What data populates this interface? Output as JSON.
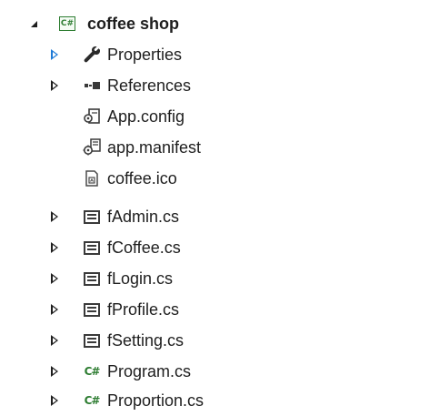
{
  "solution_explorer": {
    "project": {
      "name": "coffee shop",
      "icon": "csharp-project-icon",
      "icon_text": "C#",
      "expanded": true
    },
    "items": [
      {
        "label": "Properties",
        "icon": "wrench-icon",
        "expander": "collapsed",
        "expander_color": "#1e7ad6"
      },
      {
        "label": "References",
        "icon": "references-icon",
        "expander": "collapsed"
      },
      {
        "label": "App.config",
        "icon": "config-file-icon",
        "expander": "none"
      },
      {
        "label": "app.manifest",
        "icon": "manifest-file-icon",
        "expander": "none"
      },
      {
        "label": "coffee.ico",
        "icon": "ico-file-icon",
        "expander": "none"
      },
      {
        "label": "fAdmin.cs",
        "icon": "form-file-icon",
        "expander": "collapsed"
      },
      {
        "label": "fCoffee.cs",
        "icon": "form-file-icon",
        "expander": "collapsed"
      },
      {
        "label": "fLogin.cs",
        "icon": "form-file-icon",
        "expander": "collapsed"
      },
      {
        "label": "fProfile.cs",
        "icon": "form-file-icon",
        "expander": "collapsed"
      },
      {
        "label": "fSetting.cs",
        "icon": "form-file-icon",
        "expander": "collapsed"
      },
      {
        "label": "Program.cs",
        "icon": "csharp-file-icon",
        "icon_text": "C#",
        "expander": "collapsed"
      },
      {
        "label": "Proportion.cs",
        "icon": "csharp-file-icon",
        "icon_text": "C#",
        "expander": "collapsed"
      }
    ],
    "colors": {
      "text": "#1e1e1e",
      "csharp_green": "#2e7d32",
      "expander_blue": "#1e7ad6"
    }
  }
}
